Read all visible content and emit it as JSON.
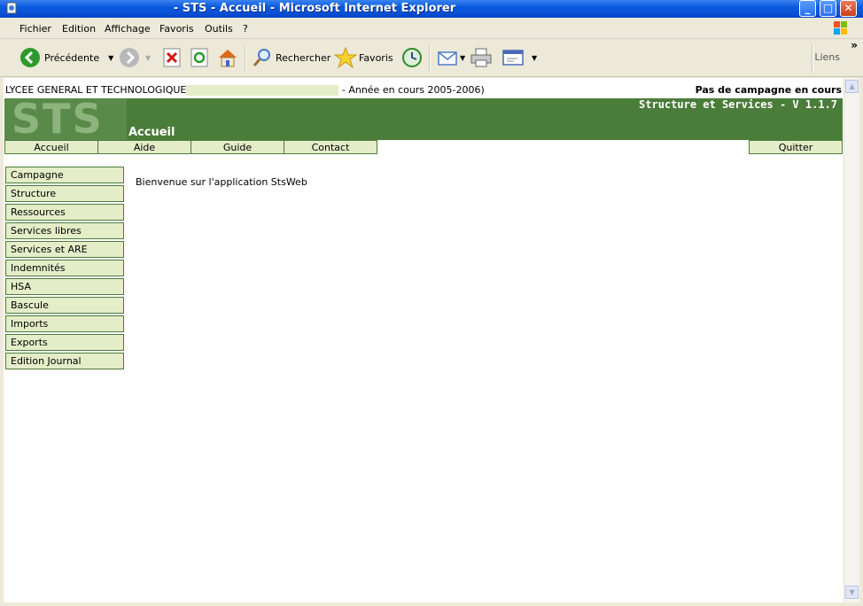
{
  "window": {
    "title": "- STS - Accueil - Microsoft Internet Explorer",
    "minimize": "_",
    "maximize": "□",
    "close": "✕"
  },
  "menu": [
    "Fichier",
    "Edition",
    "Affichage",
    "Favoris",
    "Outils",
    "?"
  ],
  "toolbar": {
    "back_label": "Précédente",
    "search_label": "Rechercher",
    "favorites_label": "Favoris",
    "links_label": "Liens",
    "overflow": "»"
  },
  "page": {
    "school": "LYCEE GENERAL ET TECHNOLOGIQUE",
    "year": "- Année en cours 2005-2006)",
    "campaign_status": "Pas de campagne en cours",
    "logo_text": "STS",
    "app_name": "Structure et Services - V 1.1.7",
    "page_title": "Accueil",
    "nav": {
      "home": "Accueil",
      "help": "Aide",
      "guide": "Guide",
      "contact": "Contact",
      "quit": "Quitter"
    },
    "sidebar": [
      "Campagne",
      "Structure",
      "Ressources",
      "Services libres",
      "Services et ARE",
      "Indemnités",
      "HSA",
      "Bascule",
      "Imports",
      "Exports",
      "Edition Journal"
    ],
    "welcome": "Bienvenue sur l'application StsWeb"
  },
  "colors": {
    "banner_green": "#4a7c3a",
    "button_bg": "#e5ecc8",
    "xp_blue": "#0a5ae0"
  }
}
